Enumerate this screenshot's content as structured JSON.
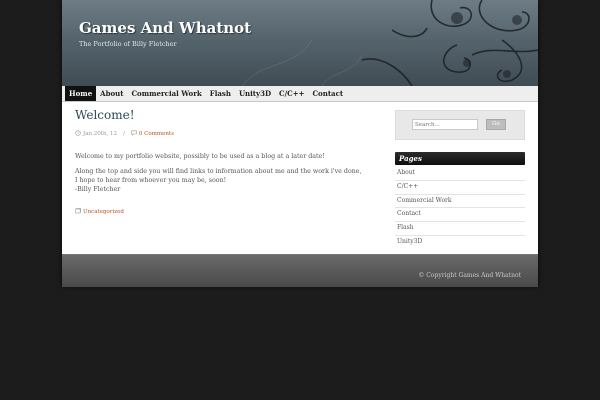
{
  "site": {
    "title": "Games And Whatnot",
    "tagline": "The Portfolio of Billy Fletcher"
  },
  "nav": {
    "items": [
      {
        "label": "Home",
        "active": true
      },
      {
        "label": "About"
      },
      {
        "label": "Commercial Work"
      },
      {
        "label": "Flash"
      },
      {
        "label": "Unity3D"
      },
      {
        "label": "C/C++"
      },
      {
        "label": "Contact"
      }
    ]
  },
  "post": {
    "title": "Welcome!",
    "date": "Jan 20th, 12",
    "comments": "0 Comments",
    "paragraph1": "Welcome to my portfolio website, possibly to be used as a blog at a later date!",
    "paragraph2_line1": "Along the top and side you will find links to information about me and the work i've done, I hope to hear from whoever you may be, soon!",
    "signature": "-Billy Fletcher",
    "category": "Uncategorized"
  },
  "sidebar": {
    "search": {
      "placeholder": "Search...",
      "button_label": "Go"
    },
    "pages_heading": "Pages",
    "pages": [
      "About",
      "C/C++",
      "Commercial Work",
      "Contact",
      "Flash",
      "Unity3D"
    ]
  },
  "footer": {
    "copyright": "© Copyright Games And Whatnot"
  },
  "colors": {
    "background": "#1c1c1c",
    "link_accent": "#b3541e",
    "title_color": "#2c4a56"
  }
}
